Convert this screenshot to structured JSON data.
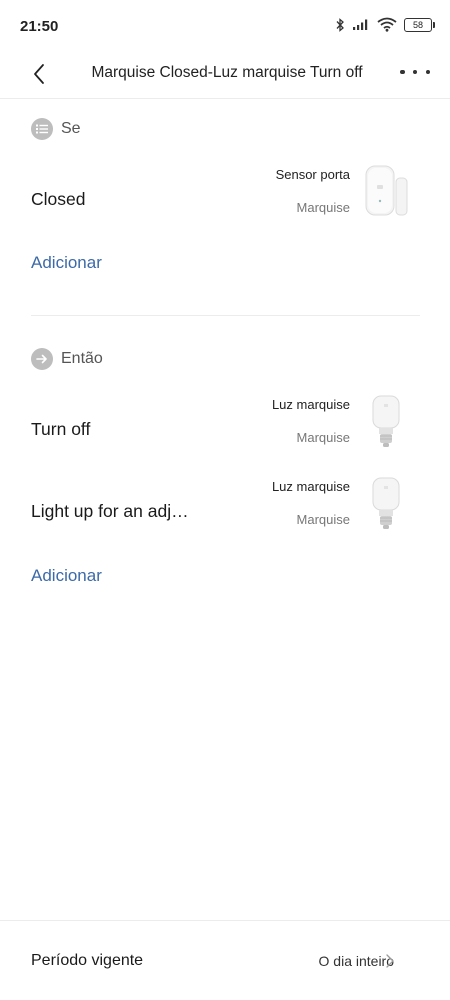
{
  "status_bar": {
    "time": "21:50",
    "battery": "58"
  },
  "header": {
    "title": "Marquise Closed-Luz marquise Turn off"
  },
  "if_section": {
    "label": "Se",
    "conditions": [
      {
        "name": "Closed",
        "device": "Sensor porta",
        "room": "Marquise",
        "icon": "door-sensor-icon"
      }
    ],
    "add_label": "Adicionar"
  },
  "then_section": {
    "label": "Então",
    "actions": [
      {
        "name": "Turn off",
        "device": "Luz marquise",
        "room": "Marquise",
        "icon": "light-bulb-icon"
      },
      {
        "name": "Light up for an adj…",
        "device": "Luz marquise",
        "room": "Marquise",
        "icon": "light-bulb-icon"
      }
    ],
    "add_label": "Adicionar"
  },
  "period": {
    "label": "Período vigente",
    "value": "O dia inteiro"
  },
  "colors": {
    "link": "#3c6aa8",
    "section_icon": "#bdbdbd"
  }
}
